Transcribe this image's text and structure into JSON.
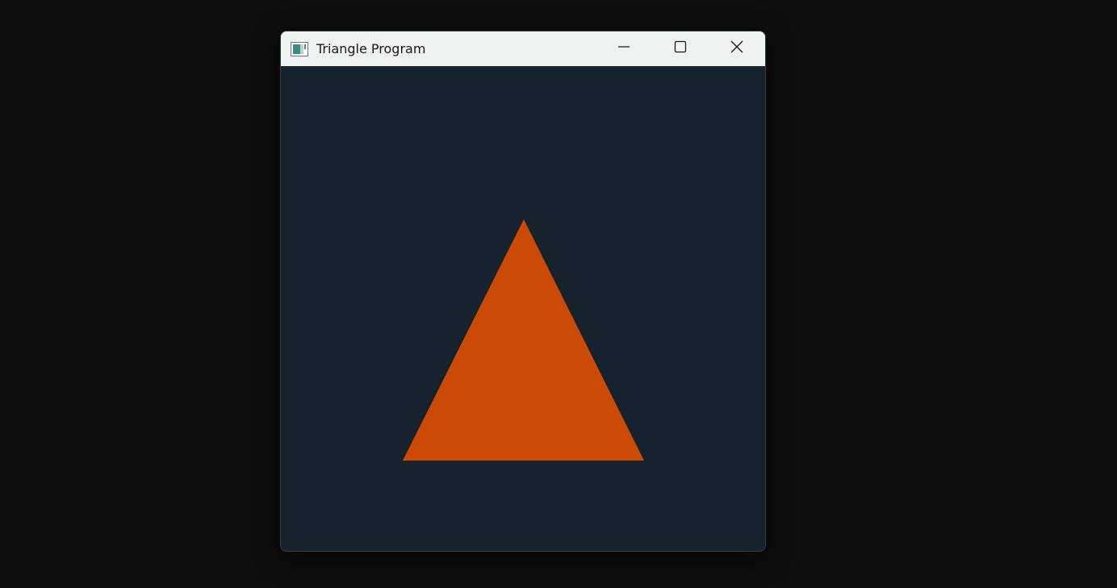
{
  "window": {
    "title": "Triangle Program",
    "icon": "app-window-icon"
  },
  "caption_buttons": {
    "minimize_icon": "minimize-icon",
    "maximize_icon": "maximize-icon",
    "close_icon": "close-icon"
  },
  "canvas": {
    "background_color": "#16222c",
    "shape": "triangle",
    "fill_color": "#cb4b06"
  },
  "colors": {
    "desktop": "#0e0e0e",
    "titlebar": "#eef2f2"
  }
}
